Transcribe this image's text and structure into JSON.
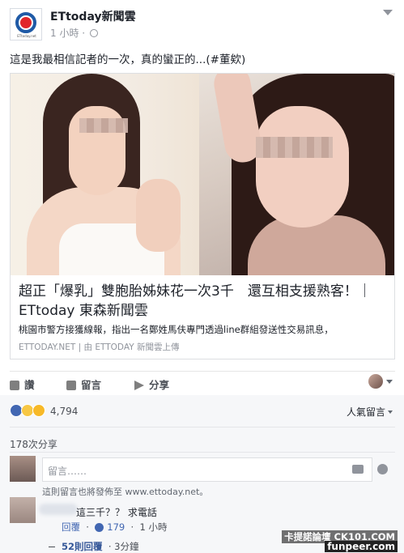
{
  "header": {
    "page_name": "ETtoday新聞雲",
    "time": "1 小時 ·",
    "logo_caption": "ETtoday.net"
  },
  "post": {
    "text": "這是我最相信記者的一次，真的蠻正的...(#董欸)"
  },
  "link_card": {
    "title": "超正「爆乳」雙胞胎姊妹花一次3千　還互相支援熟客！｜ETtoday 東森新聞雲",
    "description": "桃園市警方接獲線報，指出一名鄭姓馬伕專門透過line群組發送性交易訊息，",
    "source": "ETTODAY.NET | 由 ETTODAY 新聞雲上傳"
  },
  "actions": {
    "like": "讚",
    "comment": "留言",
    "share": "分享"
  },
  "reactions": {
    "count": "4,794",
    "icons": [
      "like-icon",
      "wow-icon",
      "haha-icon"
    ],
    "sort_label": "人氣留言"
  },
  "shares": "178次分享",
  "comment_box": {
    "placeholder": "留言……",
    "note": "這則留言也將發佈至 www.ettoday.net。"
  },
  "comment": {
    "text": "這三千？？ 求電話",
    "reply_label": "回覆",
    "likes": "179",
    "time": "1 小時"
  },
  "replies": {
    "label": "52則回覆",
    "time": "3分鐘"
  },
  "watermark": {
    "line1": "卡提諾論壇 CK101.COM",
    "line2": "funpeer.com"
  },
  "colors": {
    "facebook_blue": "#4267b2",
    "link_blue": "#365899",
    "text": "#1d2129",
    "muted": "#90949c"
  }
}
